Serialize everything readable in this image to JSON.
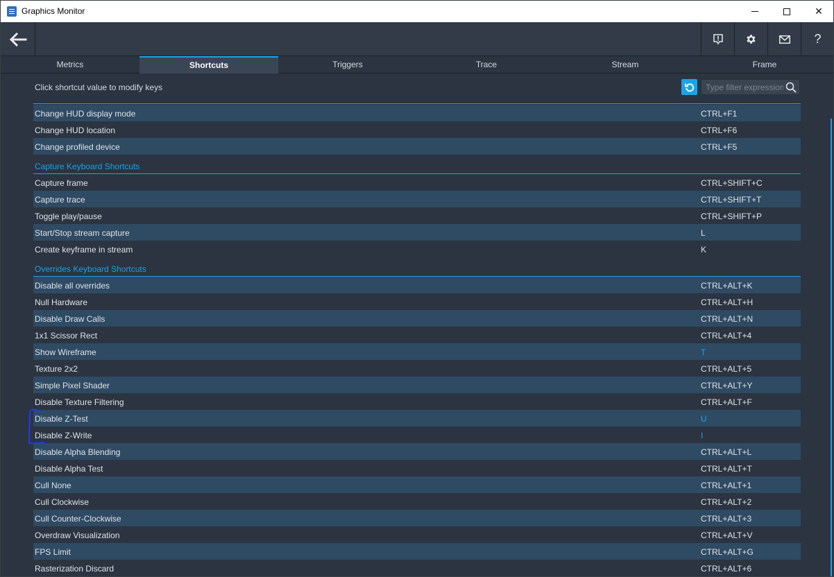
{
  "window": {
    "title": "Graphics Monitor",
    "minimize_label": "",
    "close_label": "✕"
  },
  "toolbar": {
    "help_label": "?"
  },
  "tabs": [
    {
      "label": "Metrics"
    },
    {
      "label": "Shortcuts"
    },
    {
      "label": "Triggers"
    },
    {
      "label": "Trace"
    },
    {
      "label": "Stream"
    },
    {
      "label": "Frame"
    }
  ],
  "active_tab": "Shortcuts",
  "instruction": "Click shortcut value to modify keys",
  "filter": {
    "placeholder": "Type filter expression",
    "value": ""
  },
  "colors": {
    "accent": "#1aa3e8",
    "row_alt": "#2f4a63",
    "background": "#2b3440",
    "annotation": "#1f3cf0"
  },
  "groups": [
    {
      "title": "",
      "items": [
        {
          "name": "Change HUD display mode",
          "key": "CTRL+F1"
        },
        {
          "name": "Change HUD location",
          "key": "CTRL+F6"
        },
        {
          "name": "Change profiled device",
          "key": "CTRL+F5"
        }
      ]
    },
    {
      "title": "Capture Keyboard Shortcuts",
      "items": [
        {
          "name": "Capture frame",
          "key": "CTRL+SHIFT+C"
        },
        {
          "name": "Capture trace",
          "key": "CTRL+SHIFT+T"
        },
        {
          "name": "Toggle play/pause",
          "key": "CTRL+SHIFT+P"
        },
        {
          "name": "Start/Stop stream capture",
          "key": "L"
        },
        {
          "name": "Create keyframe in stream",
          "key": "K"
        }
      ]
    },
    {
      "title": "Overrides Keyboard Shortcuts",
      "items": [
        {
          "name": "Disable all overrides",
          "key": "CTRL+ALT+K"
        },
        {
          "name": "Null Hardware",
          "key": "CTRL+ALT+H"
        },
        {
          "name": "Disable Draw Calls",
          "key": "CTRL+ALT+N"
        },
        {
          "name": "1x1 Scissor Rect",
          "key": "CTRL+ALT+4"
        },
        {
          "name": "Show Wireframe",
          "key": "T",
          "modified": true
        },
        {
          "name": "Texture 2x2",
          "key": "CTRL+ALT+5"
        },
        {
          "name": "Simple Pixel Shader",
          "key": "CTRL+ALT+Y"
        },
        {
          "name": "Disable Texture Filtering",
          "key": "CTRL+ALT+F"
        },
        {
          "name": "Disable Z-Test",
          "key": "U",
          "modified": true
        },
        {
          "name": "Disable Z-Write",
          "key": "I",
          "modified": true
        },
        {
          "name": "Disable Alpha Blending",
          "key": "CTRL+ALT+L"
        },
        {
          "name": "Disable Alpha Test",
          "key": "CTRL+ALT+T"
        },
        {
          "name": "Cull None",
          "key": "CTRL+ALT+1"
        },
        {
          "name": "Cull Clockwise",
          "key": "CTRL+ALT+2"
        },
        {
          "name": "Cull Counter-Clockwise",
          "key": "CTRL+ALT+3"
        },
        {
          "name": "Overdraw Visualization",
          "key": "CTRL+ALT+V"
        },
        {
          "name": "FPS Limit",
          "key": "CTRL+ALT+G"
        },
        {
          "name": "Rasterization Discard",
          "key": "CTRL+ALT+6"
        }
      ]
    }
  ]
}
